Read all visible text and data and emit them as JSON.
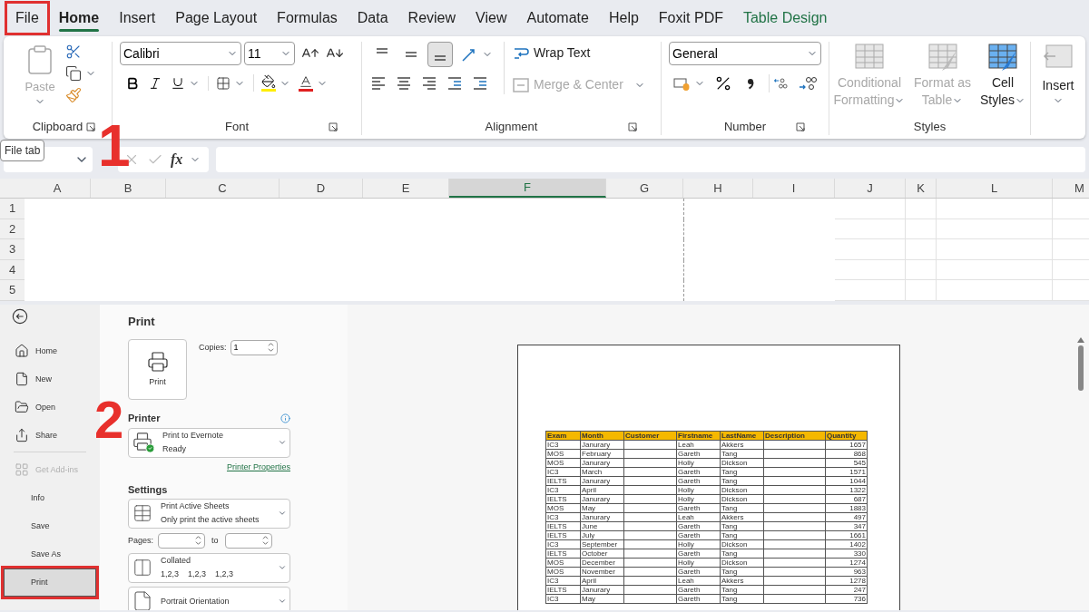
{
  "tabs": [
    {
      "label": "File",
      "selected": false,
      "kind": "normal",
      "highlighted": true
    },
    {
      "label": "Home",
      "selected": true,
      "kind": "normal",
      "highlighted": false
    },
    {
      "label": "Insert",
      "selected": false,
      "kind": "normal",
      "highlighted": false
    },
    {
      "label": "Page Layout",
      "selected": false,
      "kind": "normal",
      "highlighted": false
    },
    {
      "label": "Formulas",
      "selected": false,
      "kind": "normal",
      "highlighted": false
    },
    {
      "label": "Data",
      "selected": false,
      "kind": "normal",
      "highlighted": false
    },
    {
      "label": "Review",
      "selected": false,
      "kind": "normal",
      "highlighted": false
    },
    {
      "label": "View",
      "selected": false,
      "kind": "normal",
      "highlighted": false
    },
    {
      "label": "Automate",
      "selected": false,
      "kind": "normal",
      "highlighted": false
    },
    {
      "label": "Help",
      "selected": false,
      "kind": "normal",
      "highlighted": false
    },
    {
      "label": "Foxit PDF",
      "selected": false,
      "kind": "normal",
      "highlighted": false
    },
    {
      "label": "Table Design",
      "selected": false,
      "kind": "contextual",
      "highlighted": false
    }
  ],
  "ribbon": {
    "clipboard": {
      "paste": {
        "label": "Paste",
        "disabled": true
      },
      "name": "Clipboard"
    },
    "font": {
      "font_name": "Calibri",
      "font_size": "11",
      "name": "Font"
    },
    "alignment": {
      "vertical_buttons": [
        {
          "selected": false
        },
        {
          "selected": false
        },
        {
          "selected": true
        }
      ],
      "wrap": {
        "label": "Wrap Text",
        "disabled": false
      },
      "merge": {
        "label": "Merge & Center",
        "disabled": true
      },
      "name": "Alignment"
    },
    "number": {
      "format": "General",
      "name": "Number"
    },
    "styles": {
      "buttons": [
        {
          "label": "Conditional Formatting",
          "disabled": true
        },
        {
          "label": "Format as Table",
          "disabled": true
        },
        {
          "label": "Cell Styles",
          "disabled": false
        }
      ],
      "name": "Styles"
    },
    "cells": {
      "insert": "Insert"
    }
  },
  "tooltip": "File tab",
  "annotations": [
    "1",
    "2"
  ],
  "formula_bar": {
    "fx": "fx"
  },
  "sheet": {
    "columns": [
      {
        "label": "A",
        "selected": false
      },
      {
        "label": "B",
        "selected": false
      },
      {
        "label": "C",
        "selected": false
      },
      {
        "label": "D",
        "selected": false
      },
      {
        "label": "E",
        "selected": false
      },
      {
        "label": "F",
        "selected": true
      },
      {
        "label": "G",
        "selected": false
      },
      {
        "label": "H",
        "selected": false
      },
      {
        "label": "I",
        "selected": false
      },
      {
        "label": "J",
        "selected": false
      },
      {
        "label": "K",
        "selected": false
      },
      {
        "label": "L",
        "selected": false
      },
      {
        "label": "M",
        "selected": false
      }
    ],
    "rows": [
      "1",
      "2",
      "3",
      "4",
      "5"
    ]
  },
  "backstage": {
    "nav": [
      {
        "label": "Home",
        "kind": "home",
        "selected": false,
        "disabled": false,
        "highlighted": false
      },
      {
        "label": "New",
        "kind": "new",
        "selected": false,
        "disabled": false,
        "highlighted": false
      },
      {
        "label": "Open",
        "kind": "open",
        "selected": false,
        "disabled": false,
        "highlighted": false
      },
      {
        "label": "Share",
        "kind": "share",
        "selected": false,
        "disabled": false,
        "highlighted": false
      },
      {
        "label": "Get Add-ins",
        "kind": "addins",
        "selected": false,
        "disabled": true,
        "highlighted": false
      },
      {
        "label": "Info",
        "kind": "plain",
        "selected": false,
        "disabled": false,
        "highlighted": false
      },
      {
        "label": "Save",
        "kind": "plain",
        "selected": false,
        "disabled": false,
        "highlighted": false
      },
      {
        "label": "Save As",
        "kind": "plain",
        "selected": false,
        "disabled": false,
        "highlighted": false
      },
      {
        "label": "Print",
        "kind": "plain",
        "selected": true,
        "disabled": false,
        "highlighted": true
      }
    ],
    "print": {
      "title": "Print",
      "button": "Print",
      "copies_label": "Copies:",
      "copies": "1",
      "printer_heading": "Printer",
      "printer": {
        "name": "Print to Evernote",
        "status": "Ready"
      },
      "printer_properties": "Printer Properties",
      "settings_heading": "Settings",
      "settings": [
        {
          "kind": "sheets",
          "title": "Print Active Sheets",
          "subtitle": "Only print the active sheets"
        },
        {
          "kind": "pages"
        },
        {
          "kind": "collated",
          "title": "Collated",
          "subtitle": "1,2,3    1,2,3    1,2,3"
        },
        {
          "kind": "orientation",
          "title": "Portrait Orientation"
        }
      ],
      "pages_label": "Pages:",
      "to_label": "to"
    }
  },
  "preview": {
    "columns": [
      "Exam",
      "Month",
      "Customer",
      "Firstname",
      "LastName",
      "Description",
      "Quantity"
    ],
    "rows": [
      {
        "exam": "IC3",
        "month": "Janurary",
        "firstname": "Leah",
        "lastname": "Akkers",
        "quantity": "1657"
      },
      {
        "exam": "MOS",
        "month": "February",
        "firstname": "Gareth",
        "lastname": "Tang",
        "quantity": "868"
      },
      {
        "exam": "MOS",
        "month": "Janurary",
        "firstname": "Holly",
        "lastname": "Dickson",
        "quantity": "545"
      },
      {
        "exam": "IC3",
        "month": "March",
        "firstname": "Gareth",
        "lastname": "Tang",
        "quantity": "1571"
      },
      {
        "exam": "IELTS",
        "month": "Janurary",
        "firstname": "Gareth",
        "lastname": "Tang",
        "quantity": "1044"
      },
      {
        "exam": "IC3",
        "month": "April",
        "firstname": "Holly",
        "lastname": "Dickson",
        "quantity": "1322"
      },
      {
        "exam": "IELTS",
        "month": "Janurary",
        "firstname": "Holly",
        "lastname": "Dickson",
        "quantity": "687"
      },
      {
        "exam": "MOS",
        "month": "May",
        "firstname": "Gareth",
        "lastname": "Tang",
        "quantity": "1883"
      },
      {
        "exam": "IC3",
        "month": "Janurary",
        "firstname": "Leah",
        "lastname": "Akkers",
        "quantity": "497"
      },
      {
        "exam": "IELTS",
        "month": "June",
        "firstname": "Gareth",
        "lastname": "Tang",
        "quantity": "347"
      },
      {
        "exam": "IELTS",
        "month": "July",
        "firstname": "Gareth",
        "lastname": "Tang",
        "quantity": "1661"
      },
      {
        "exam": "IC3",
        "month": "September",
        "firstname": "Holly",
        "lastname": "Dickson",
        "quantity": "1402"
      },
      {
        "exam": "IELTS",
        "month": "October",
        "firstname": "Gareth",
        "lastname": "Tang",
        "quantity": "330"
      },
      {
        "exam": "MOS",
        "month": "December",
        "firstname": "Holly",
        "lastname": "Dickson",
        "quantity": "1274"
      },
      {
        "exam": "MOS",
        "month": "November",
        "firstname": "Gareth",
        "lastname": "Tang",
        "quantity": "963"
      },
      {
        "exam": "IC3",
        "month": "April",
        "firstname": "Leah",
        "lastname": "Akkers",
        "quantity": "1278"
      },
      {
        "exam": "IELTS",
        "month": "Janurary",
        "firstname": "Gareth",
        "lastname": "Tang",
        "quantity": "247"
      },
      {
        "exam": "IC3",
        "month": "May",
        "firstname": "Gareth",
        "lastname": "Tang",
        "quantity": "736"
      }
    ]
  }
}
